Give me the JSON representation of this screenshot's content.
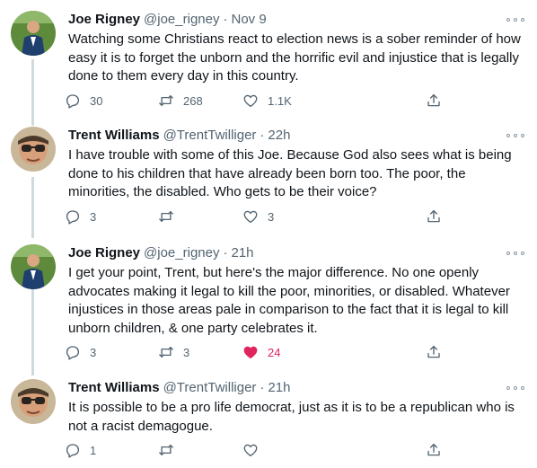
{
  "tweets": [
    {
      "name": "Joe Rigney",
      "handle": "@joe_rigney",
      "sep": "·",
      "time": "Nov 9",
      "text": "Watching some Christians react to election news is a sober reminder of how easy it is to forget the unborn and the horrific evil and injustice that is legally done to them every day in this country.",
      "replies": "30",
      "retweets": "268",
      "likes": "1.1K",
      "liked": false
    },
    {
      "name": "Trent Williams",
      "handle": "@TrentTwilliger",
      "sep": "·",
      "time": "22h",
      "text": "I have trouble with some of this Joe. Because God also sees what is being done to his children that have already been born too. The poor, the minorities, the disabled. Who gets to be their voice?",
      "replies": "3",
      "retweets": "",
      "likes": "3",
      "liked": false
    },
    {
      "name": "Joe Rigney",
      "handle": "@joe_rigney",
      "sep": "·",
      "time": "21h",
      "text": "I get your point, Trent, but here's the major difference. No one openly advocates making it legal to kill the poor, minorities, or disabled. Whatever injustices in those areas pale in comparison to the fact that it is legal to kill unborn children, & one party celebrates it.",
      "replies": "3",
      "retweets": "3",
      "likes": "24",
      "liked": true
    },
    {
      "name": "Trent Williams",
      "handle": "@TrentTwilliger",
      "sep": "·",
      "time": "21h",
      "text": "It is possible to be a pro life democrat, just as it is to be a republican who is not a racist demagogue.",
      "replies": "1",
      "retweets": "",
      "likes": "",
      "liked": false
    }
  ],
  "colors": {
    "text": "#0f1419",
    "secondary": "#536471",
    "like_active": "#e0245e",
    "thread_line": "#cfd9de"
  },
  "icons": [
    "reply-icon",
    "retweet-icon",
    "like-icon",
    "share-icon",
    "more-icon"
  ]
}
